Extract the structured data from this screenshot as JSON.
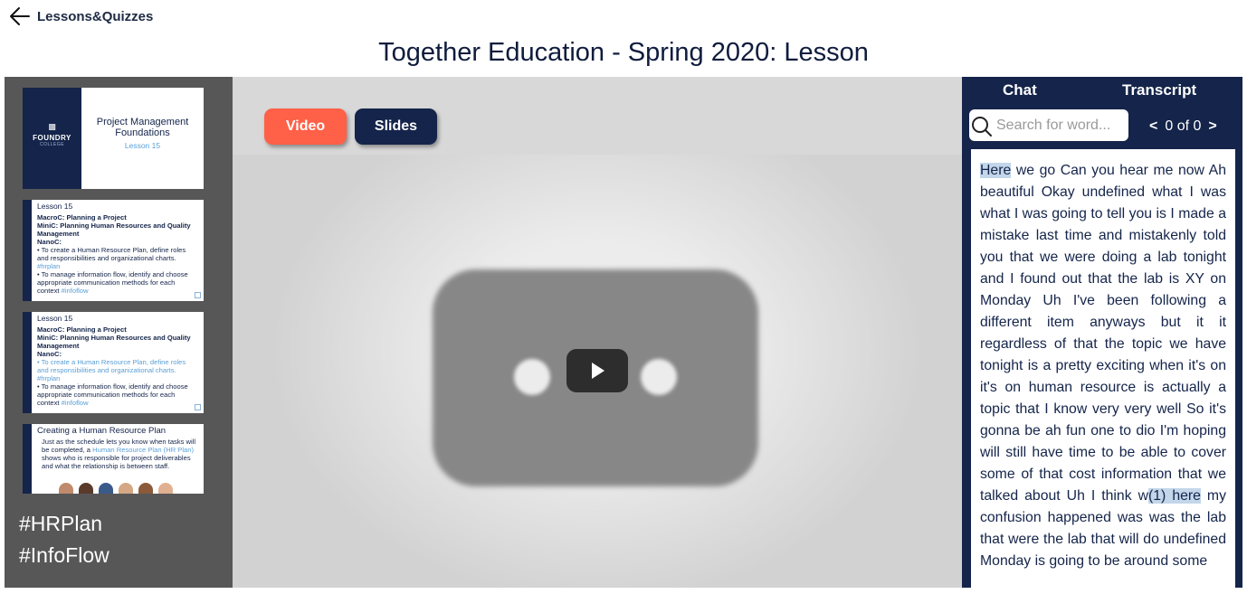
{
  "nav": {
    "back_label": "Lessons&Quizzes"
  },
  "page": {
    "title": "Together Education - Spring 2020: Lesson"
  },
  "slides": {
    "thumb1": {
      "brand": "FOUNDRY",
      "brand_sub": "COLLEGE",
      "title": "Project Management Foundations",
      "lesson": "Lesson 15"
    },
    "thumb2": {
      "heading": "Lesson 15",
      "macro": "MacroC: Planning a Project",
      "mini": "MiniC: Planning Human Resources and Quality Management",
      "nano": "NanoC:",
      "bullet1": "To create a Human Resource Plan, define roles and responsibilities and organizational charts.",
      "tag1": "#hrplan",
      "bullet2": "To manage information flow, identify and choose appropriate communication methods for each context",
      "tag2": "#infoflow"
    },
    "thumb3": {
      "heading": "Lesson 15",
      "macro": "MacroC: Planning a Project",
      "mini": "MiniC: Planning Human Resources and Quality Management",
      "nano": "NanoC:",
      "bullet1": "To create a Human Resource Plan, define roles and responsibilities and organizational charts.",
      "tag1": "#hrplan",
      "bullet2": "To manage information flow, identify and choose appropriate communication methods for each context",
      "tag2": "#infoflow"
    },
    "thumb4": {
      "heading": "Creating a Human Resource Plan",
      "body_a": "Just as the schedule lets you know when tasks will be completed, a",
      "body_link": "Human Resource Plan (HR Plan)",
      "body_b": "shows who is responsible for project deliverables and what the relationship is between staff."
    },
    "hashtags": [
      "#HRPlan",
      "#InfoFlow"
    ]
  },
  "media": {
    "video_label": "Video",
    "slides_label": "Slides"
  },
  "panel": {
    "tab_chat": "Chat",
    "tab_transcript": "Transcript",
    "search_placeholder": "Search for word...",
    "pager_prev": "<",
    "pager_text": "0 of 0",
    "pager_next": ">",
    "transcript_highlight1": "Here",
    "transcript_part1": " we go Can you hear me now Ah beautiful Okay undefined what I was what I was going to tell you is I made a mistake last time and mistakenly told you that we were doing a lab tonight and I found out that the lab is XY on Monday Uh I've been following a different item anyways but it it regardless of that the topic we have tonight is a pretty exciting when it's on it's on human resource is actually a topic that I know very very well So it's gonna be ah fun one to dio I'm hoping will still have time to be able to cover some of that cost information that we talked about Uh I think w",
    "transcript_highlight2": "(1) here",
    "transcript_part2": " my confusion happened was was the lab that were the lab that will do undefined Monday is going to be around some"
  },
  "colors": {
    "navy": "#14244a",
    "accent": "#ff6048",
    "sidebar": "#575757",
    "highlight": "#c3d6ea"
  },
  "icons": {
    "back": "arrow-left-icon",
    "play": "play-icon",
    "search": "search-icon"
  }
}
